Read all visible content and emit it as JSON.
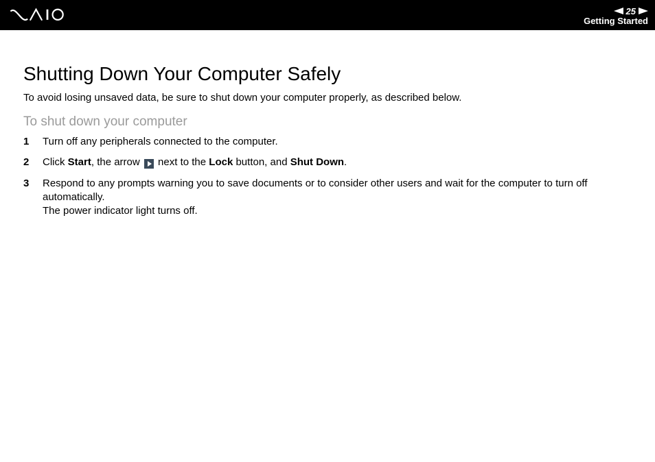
{
  "header": {
    "page_number": "25",
    "section": "Getting Started"
  },
  "content": {
    "title": "Shutting Down Your Computer Safely",
    "intro": "To avoid losing unsaved data, be sure to shut down your computer properly, as described below.",
    "subhead": "To shut down your computer",
    "steps": [
      {
        "num": "1",
        "text_plain": "Turn off any peripherals connected to the computer."
      },
      {
        "num": "2",
        "pre": "Click ",
        "b1": "Start",
        "mid1": ", the arrow ",
        "mid2": " next to the ",
        "b2": "Lock",
        "mid3": " button, and ",
        "b3": "Shut Down",
        "post": "."
      },
      {
        "num": "3",
        "line1": "Respond to any prompts warning you to save documents or to consider other users and wait for the computer to turn off automatically.",
        "line2": "The power indicator light turns off."
      }
    ]
  }
}
